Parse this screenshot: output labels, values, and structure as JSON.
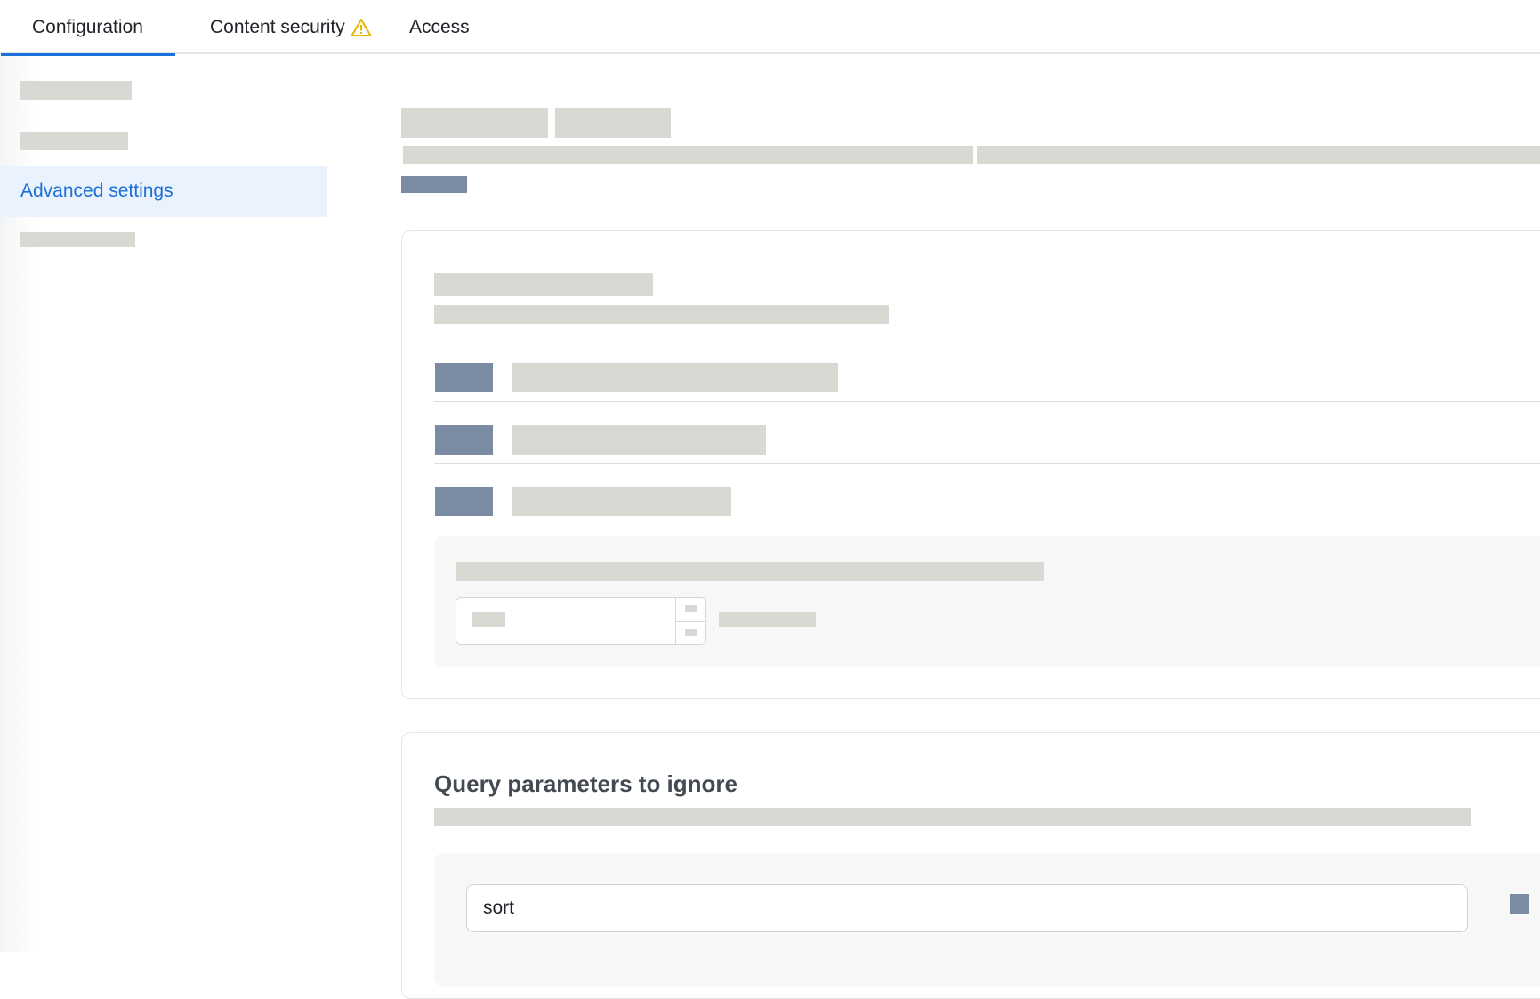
{
  "tabs": [
    {
      "label": "Configuration",
      "active": true
    },
    {
      "label": "Content security",
      "active": false,
      "icon": "warning-icon"
    },
    {
      "label": "Access",
      "active": false
    }
  ],
  "sidebar": {
    "active_item": "Advanced settings"
  },
  "query_params_section": {
    "title": "Query parameters to ignore",
    "input_value": "sort"
  },
  "colors": {
    "accent": "#1b6fd8",
    "warning": "#e5b700",
    "skeleton": "#d9d8d3",
    "skeleton_dark": "#7b8ba3"
  }
}
